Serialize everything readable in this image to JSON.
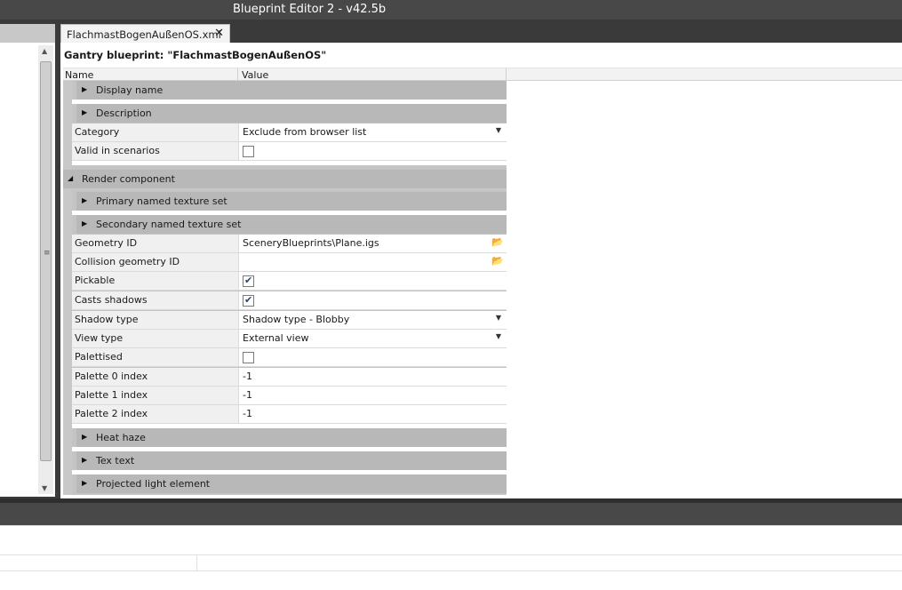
{
  "window": {
    "title": "Blueprint Editor 2 - v42.5b"
  },
  "tab": {
    "label": "FlachmastBogenAußenOS.xml",
    "close": "✕"
  },
  "document": {
    "title": "Gantry blueprint: \"FlachmastBogenAußenOS\""
  },
  "grid": {
    "header_name": "Name",
    "header_value": "Value",
    "groups": {
      "display_name": "Display name",
      "description": "Description",
      "render_component": "Render component",
      "primary_texture": "Primary named texture set",
      "secondary_texture": "Secondary named texture set",
      "heat_haze": "Heat haze",
      "tex_text": "Tex text",
      "projected_light": "Projected light element"
    },
    "rows": {
      "category": {
        "name": "Category",
        "value": "Exclude from browser list"
      },
      "valid_in_scenarios": {
        "name": "Valid in scenarios",
        "checked": false
      },
      "geometry_id": {
        "name": "Geometry ID",
        "value": "SceneryBlueprints\\Plane.igs"
      },
      "collision_geometry_id": {
        "name": "Collision geometry ID",
        "value": ""
      },
      "pickable": {
        "name": "Pickable",
        "checked": true
      },
      "casts_shadows": {
        "name": "Casts shadows",
        "checked": true
      },
      "shadow_type": {
        "name": "Shadow type",
        "value": "Shadow type - Blobby"
      },
      "view_type": {
        "name": "View type",
        "value": "External view"
      },
      "palettised": {
        "name": "Palettised",
        "checked": false
      },
      "palette0": {
        "name": "Palette 0 index",
        "value": "-1"
      },
      "palette1": {
        "name": "Palette 1 index",
        "value": "-1"
      },
      "palette2": {
        "name": "Palette 2 index",
        "value": "-1"
      }
    }
  },
  "icons": {
    "collapsed": "▶",
    "expanded": "◢",
    "dropdown": "▼",
    "folder": "📂",
    "scroll_up": "▲",
    "scroll_down": "▼",
    "grip": "≡"
  }
}
